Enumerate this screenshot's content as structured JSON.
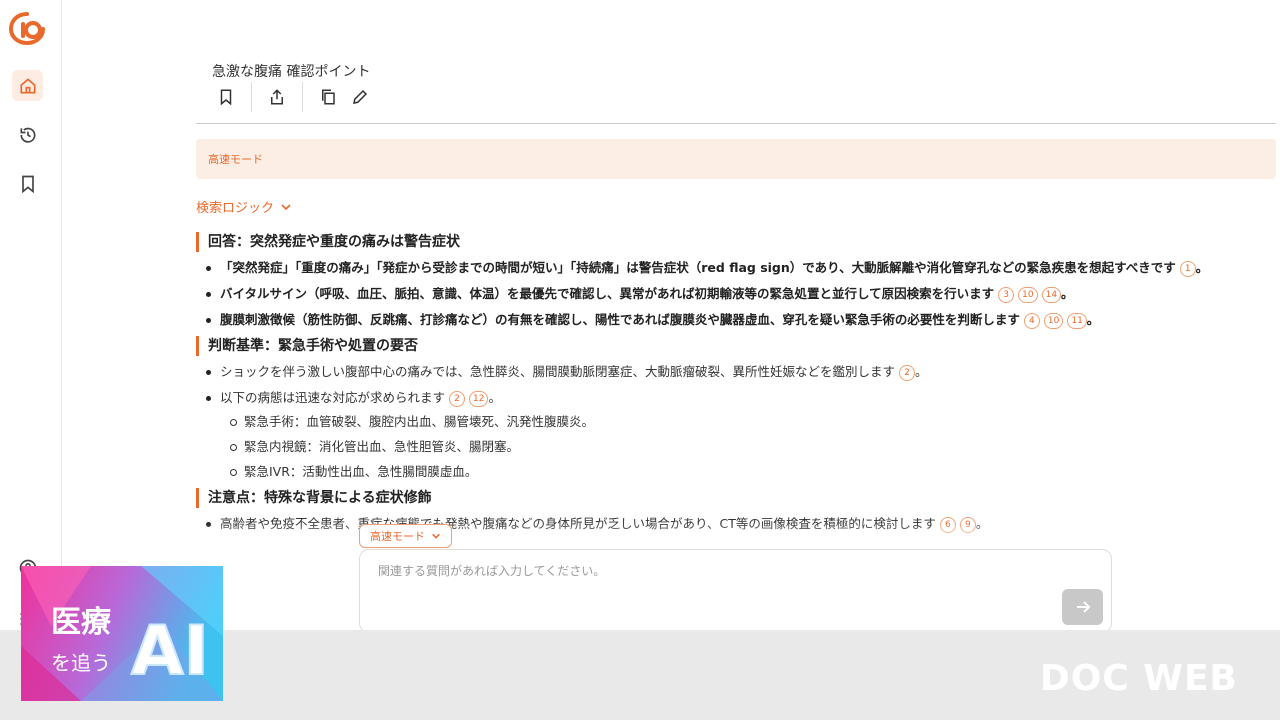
{
  "header": {
    "title": "急激な腹痛 確認ポイント"
  },
  "mode_banner": {
    "label": "高速モード"
  },
  "search_logic": {
    "label": "検索ロジック"
  },
  "sections": [
    {
      "heading": "回答：突然発症や重度の痛みは警告症状",
      "items": [
        {
          "text": "「突然発症」「重度の痛み」「発症から受診までの時間が短い」「持続痛」は警告症状（red flag sign）であり、大動脈解離や消化管穿孔などの緊急疾患を想起すべきです",
          "refs": [
            "1"
          ],
          "tail": "。"
        },
        {
          "text": "バイタルサイン（呼吸、血圧、脈拍、意識、体温）を最優先で確認し、異常があれば初期輸液等の緊急処置と並行して原因検索を行います",
          "refs": [
            "3",
            "10",
            "14"
          ],
          "tail": "。"
        },
        {
          "text": "腹膜刺激徴候（筋性防御、反跳痛、打診痛など）の有無を確認し、陽性であれば腹膜炎や臓器虚血、穿孔を疑い緊急手術の必要性を判断します",
          "refs": [
            "4",
            "10",
            "11"
          ],
          "tail": "。"
        }
      ]
    },
    {
      "heading": "判断基準：緊急手術や処置の要否",
      "items": [
        {
          "text": "ショックを伴う激しい腹部中心の痛みでは、急性膵炎、腸間膜動脈閉塞症、大動脈瘤破裂、異所性妊娠などを鑑別します",
          "refs": [
            "2"
          ],
          "tail": "。"
        },
        {
          "text": "以下の病態は迅速な対応が求められます",
          "refs": [
            "2",
            "12"
          ],
          "tail": "。",
          "sub": [
            "緊急手術：血管破裂、腹腔内出血、腸管壊死、汎発性腹膜炎。",
            "緊急内視鏡：消化管出血、急性胆管炎、腸閉塞。",
            "緊急IVR：活動性出血、急性腸間膜虚血。"
          ]
        }
      ]
    },
    {
      "heading": "注意点：特殊な背景による症状修飾",
      "items": [
        {
          "text": "高齢者や免疫不全患者、重症な病態でも発熱や腹痛などの身体所見が乏しい場合があり、CT等の画像検査を積極的に検討します",
          "refs": [
            "6",
            "9"
          ],
          "tail": "。"
        }
      ]
    }
  ],
  "mode_chip": {
    "label": "高速モード"
  },
  "input": {
    "placeholder": "関連する質問があれば入力してください。",
    "value": ""
  },
  "promo": {
    "text_main": "医療",
    "text_sub": "を追う",
    "text_ai": "AI"
  },
  "brand": {
    "label": "DOC WEB"
  },
  "colors": {
    "accent": "#e8692b",
    "banner_bg": "#fdeee5"
  }
}
